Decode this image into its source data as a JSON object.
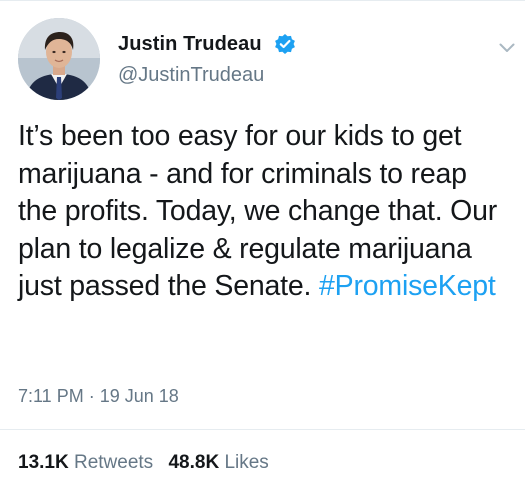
{
  "author": {
    "name": "Justin Trudeau",
    "handle": "@JustinTrudeau",
    "verified": true
  },
  "tweet": {
    "text": "It’s been too easy for our kids to get marijuana - and for criminals to reap the profits. Today, we change that. Our plan to legalize & regulate marijuana just passed the Senate.",
    "hashtag": "#PromiseKept",
    "timestamp": "7:11 PM · 19 Jun 18"
  },
  "stats": {
    "retweets_count": "13.1K",
    "retweets_label": "Retweets",
    "likes_count": "48.8K",
    "likes_label": "Likes"
  },
  "colors": {
    "link_blue": "#1da1f2",
    "secondary_text": "#657786",
    "primary_text": "#14171a",
    "verified_badge": "#1da1f2"
  },
  "icons": {
    "verified": "verified-badge-icon",
    "caret": "chevron-down-icon"
  }
}
